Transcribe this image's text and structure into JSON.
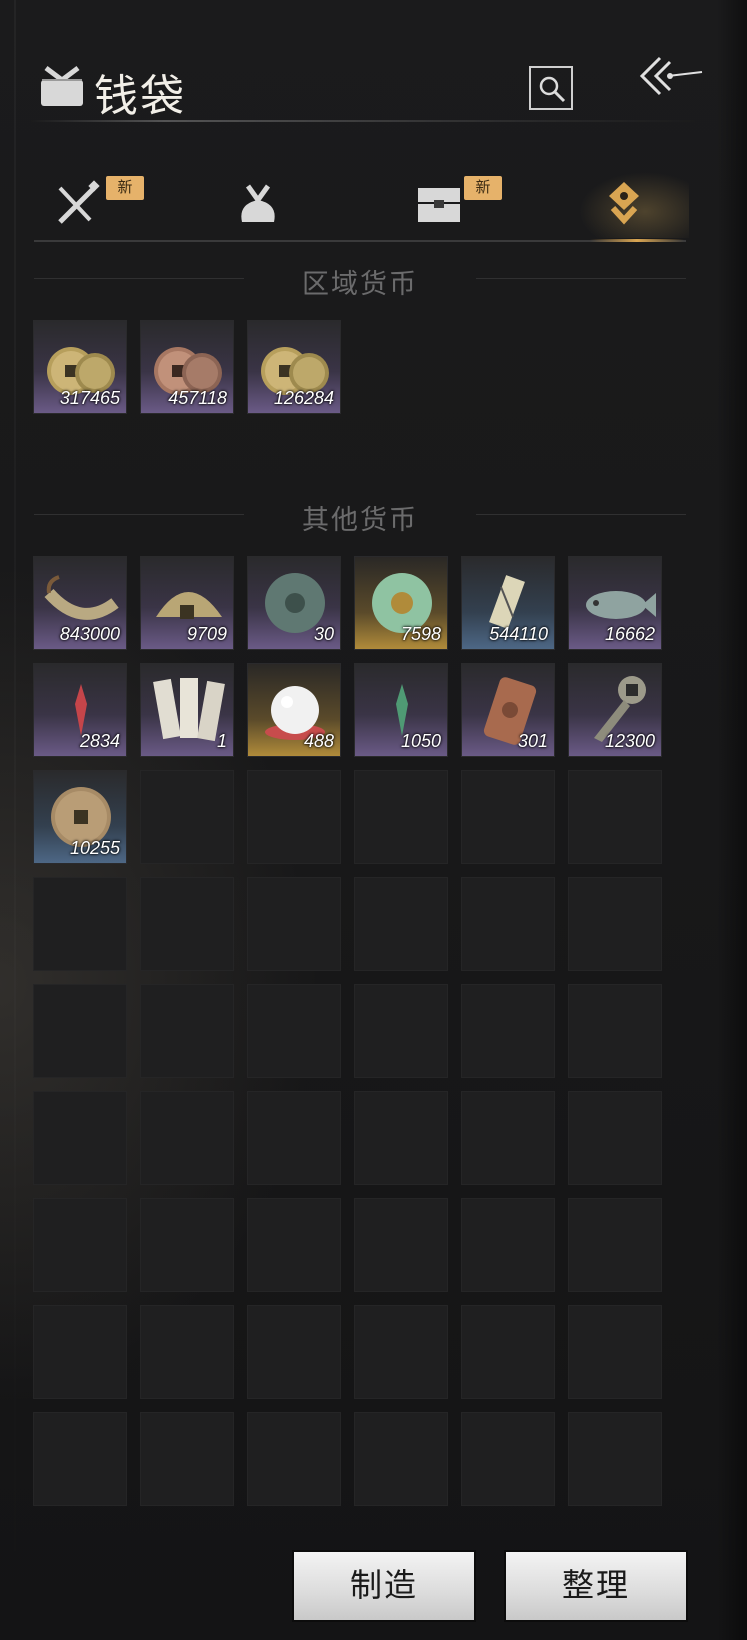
{
  "header": {
    "title": "钱袋"
  },
  "tabs": [
    {
      "name": "weapons",
      "badge": "新",
      "active": false
    },
    {
      "name": "bag",
      "badge": "",
      "active": false
    },
    {
      "name": "chest",
      "badge": "新",
      "active": false
    },
    {
      "name": "currency",
      "badge": "",
      "active": true
    }
  ],
  "sections": {
    "regional": {
      "label": "区域货币"
    },
    "other": {
      "label": "其他货币"
    }
  },
  "regional_items": [
    {
      "icon": "gold-coins-icon",
      "count": "317465",
      "rarity": "purple"
    },
    {
      "icon": "copper-coins-icon",
      "count": "457118",
      "rarity": "purple"
    },
    {
      "icon": "gold-coins-icon",
      "count": "126284",
      "rarity": "purple"
    }
  ],
  "other_items": [
    {
      "icon": "coin-string-icon",
      "count": "843000",
      "rarity": "purple"
    },
    {
      "icon": "half-coin-icon",
      "count": "9709",
      "rarity": "purple"
    },
    {
      "icon": "jade-medallion-icon",
      "count": "30",
      "rarity": "purple"
    },
    {
      "icon": "jade-ring-icon",
      "count": "7598",
      "rarity": "gold"
    },
    {
      "icon": "ticket-icon",
      "count": "544110",
      "rarity": "blue"
    },
    {
      "icon": "fish-icon",
      "count": "16662",
      "rarity": "purple"
    },
    {
      "icon": "red-crystal-icon",
      "count": "2834",
      "rarity": "purple"
    },
    {
      "icon": "paper-notes-icon",
      "count": "1",
      "rarity": "purple"
    },
    {
      "icon": "pearl-icon",
      "count": "488",
      "rarity": "gold"
    },
    {
      "icon": "green-crystal-icon",
      "count": "1050",
      "rarity": "purple"
    },
    {
      "icon": "bronze-token-icon",
      "count": "301",
      "rarity": "purple"
    },
    {
      "icon": "spade-coin-icon",
      "count": "12300",
      "rarity": "purple"
    },
    {
      "icon": "bronze-coin-icon",
      "count": "10255",
      "rarity": "blue"
    }
  ],
  "colors": {
    "purple_rarity": "#6a5a86",
    "gold_rarity": "#b08b3a",
    "blue_rarity": "#4d6785",
    "badge": "#e6b26a",
    "accent": "#d9a552"
  },
  "buttons": {
    "craft": "制造",
    "sort": "整理"
  }
}
